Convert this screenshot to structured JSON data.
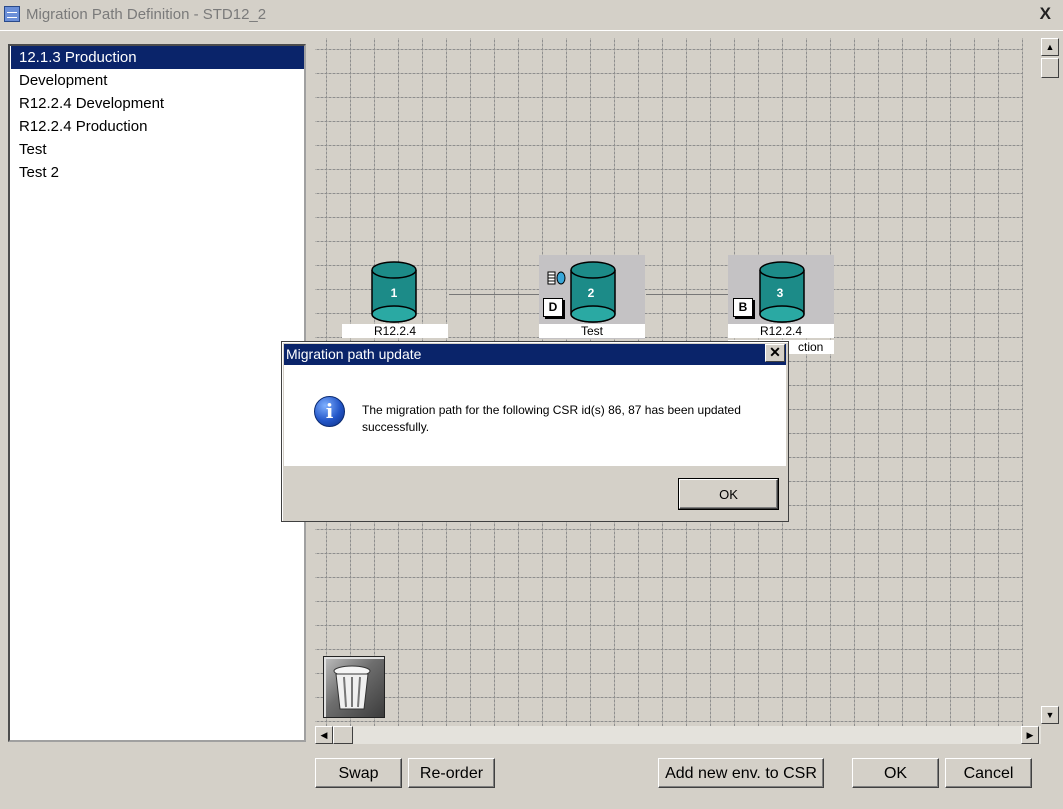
{
  "window": {
    "title": "Migration Path Definition - STD12_2",
    "close_glyph": "X"
  },
  "environments": [
    {
      "label": "12.1.3 Production",
      "selected": true
    },
    {
      "label": "Development",
      "selected": false
    },
    {
      "label": "R12.2.4 Development",
      "selected": false
    },
    {
      "label": "R12.2.4 Production",
      "selected": false
    },
    {
      "label": "Test",
      "selected": false
    },
    {
      "label": "Test 2",
      "selected": false
    }
  ],
  "path_nodes": [
    {
      "number": "1",
      "label": "R12.2.4",
      "badge": ""
    },
    {
      "number": "2",
      "label": "Test",
      "badge": "D"
    },
    {
      "number": "3",
      "label": "R12.2.4",
      "label2": "ction",
      "badge": "B"
    }
  ],
  "buttons": {
    "swap": "Swap",
    "reorder": "Re-order",
    "add_env": "Add new env. to CSR",
    "ok": "OK",
    "cancel": "Cancel"
  },
  "dialog": {
    "title": "Migration path update",
    "close_glyph": "✕",
    "message": "The migration path for the following CSR id(s) 86, 87 has been updated successfully.",
    "ok_label": "OK",
    "icon_glyph": "i"
  },
  "colors": {
    "selection": "#0a246a",
    "cylinder": "#1c8b88",
    "titlebar_dialog": "#0a246a"
  },
  "scroll": {
    "up": "▲",
    "down": "▼",
    "left": "◀",
    "right": "▶"
  }
}
